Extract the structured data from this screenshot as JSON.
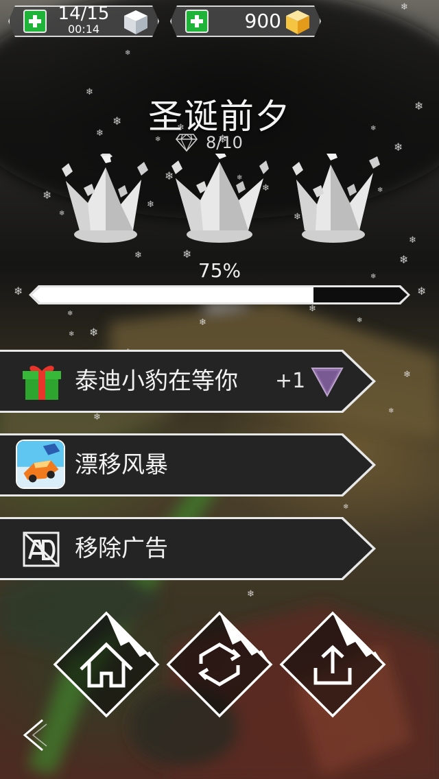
{
  "top_bar": {
    "energy": {
      "count": "14/15",
      "timer": "00:14",
      "icon": "ice-cube-icon",
      "add_icon": "plus-icon"
    },
    "gems": {
      "count": "900",
      "icon": "gold-cube-icon",
      "add_icon": "plus-icon"
    }
  },
  "level": {
    "title": "圣诞前夕",
    "gems_collected": "8/10",
    "gem_icon": "diamond-icon",
    "crowns_earned": 3,
    "crowns_total": 3,
    "progress_text": "75%",
    "progress": 0.75
  },
  "menu": [
    {
      "label": "泰迪小豹在等你",
      "icon": "gift-icon",
      "bonus": "+1",
      "bonus_icon": "purple-triangle-icon"
    },
    {
      "label": "漂移风暴",
      "icon": "drift-storm-app-icon"
    },
    {
      "label": "移除广告",
      "icon": "no-ads-icon"
    }
  ],
  "bottom_buttons": [
    {
      "name": "home",
      "icon": "home-icon"
    },
    {
      "name": "restart",
      "icon": "restart-icon"
    },
    {
      "name": "share",
      "icon": "share-icon"
    }
  ],
  "back_icon": "chevron-left-icon",
  "colors": {
    "plus_green": "#1fb33a",
    "triangle_purple": "#8c6aa3",
    "gift_green": "#2ea52e",
    "gift_red": "#e8342a",
    "gold": "#f0b21e"
  }
}
